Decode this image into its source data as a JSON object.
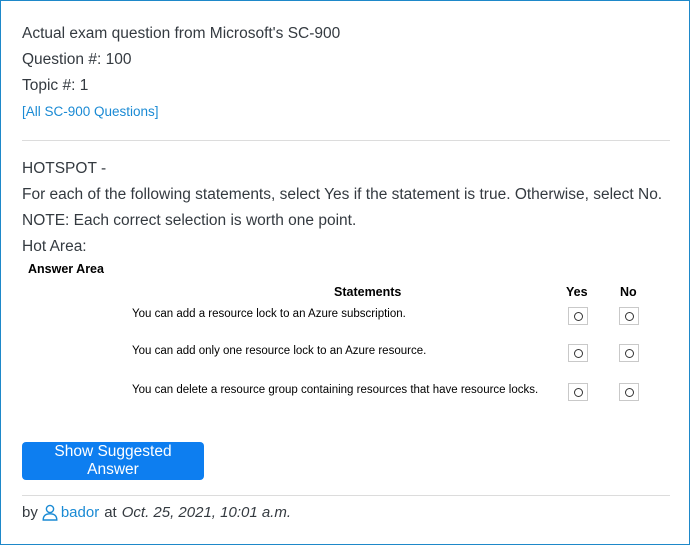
{
  "header": {
    "title": "Actual exam question from Microsoft's SC-900",
    "question_number": "Question #: 100",
    "topic": "Topic #: 1",
    "all_questions_link": "[All SC-900 Questions]"
  },
  "question": {
    "type_label": "HOTSPOT -",
    "instruction": "For each of the following statements, select Yes if the statement is true. Otherwise, select No.",
    "note": "NOTE: Each correct selection is worth one point.",
    "hot_area_label": "Hot Area:"
  },
  "answer_area": {
    "label": "Answer Area",
    "columns": {
      "statements": "Statements",
      "yes": "Yes",
      "no": "No"
    },
    "statements": [
      "You can add a resource lock to an Azure subscription.",
      "You can add only one resource lock to an Azure resource.",
      "You can delete a resource group containing resources that have resource locks."
    ]
  },
  "actions": {
    "show_answer_label": "Show Suggested Answer"
  },
  "footer": {
    "by_label": "by",
    "username": "bador",
    "at_label": "at",
    "date": "Oct. 25, 2021, 10:01 a.m."
  },
  "colors": {
    "accent": "#0d7ef0",
    "link": "#1a8ad4",
    "border": "#1e88c9"
  }
}
